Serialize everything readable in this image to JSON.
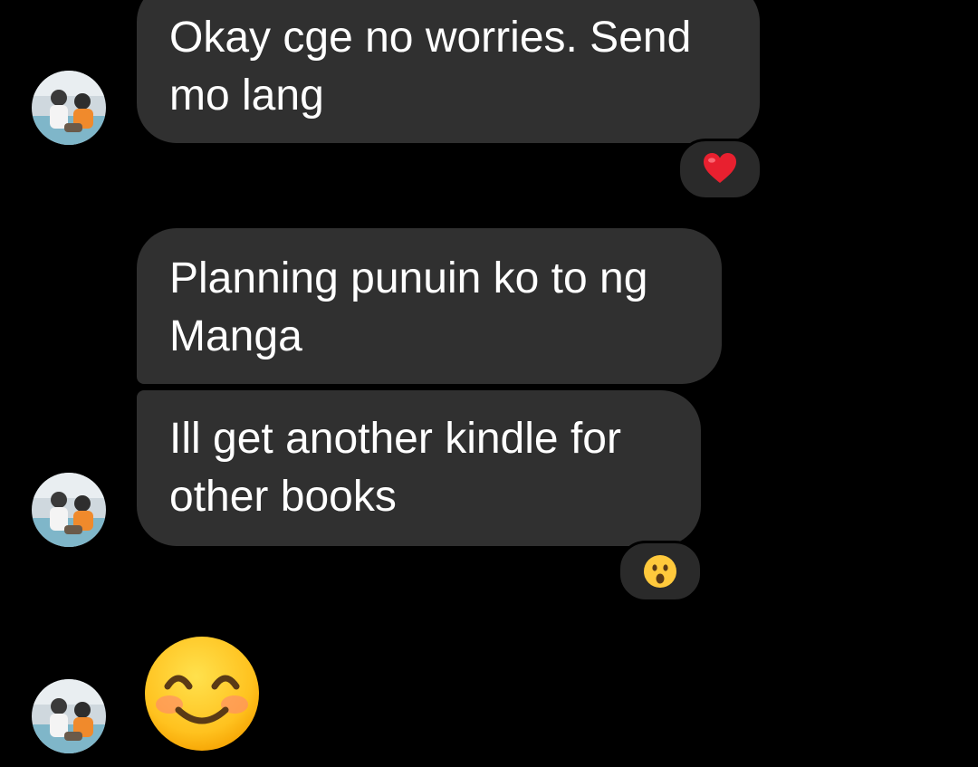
{
  "messages": [
    {
      "text": "Okay cge no worries. Send mo lang",
      "reaction": "red-heart"
    },
    {
      "text": "Planning punuin ko to ng Manga",
      "reaction": null
    },
    {
      "text": "Ill get another kindle for other books",
      "reaction": "astonished-face"
    },
    {
      "emoji": "smiling-face-with-smiling-eyes"
    }
  ],
  "colors": {
    "background": "#000000",
    "bubble": "#303030",
    "text": "#ffffff",
    "heart": "#e8202f",
    "emoji_yellow": "#ffc93c"
  }
}
